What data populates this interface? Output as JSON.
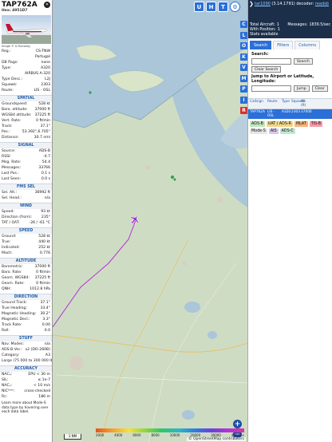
{
  "left_panel": {
    "callsign": "TAP762A",
    "hex_label": "Hex:",
    "hex": "4951D7",
    "photo_credit": "Image © G.Runsaeg",
    "rows_top": [
      {
        "k": "Reg.:",
        "v": "CS-TNW"
      },
      {
        "k": "",
        "v": "Portugal"
      },
      {
        "k": "DB flags:",
        "v": "none"
      },
      {
        "k": "Type:",
        "v": "A320"
      },
      {
        "k": "",
        "v": "AIRBUS A-320"
      },
      {
        "k": "Type Desc.:",
        "v": "L2J"
      },
      {
        "k": "Squawk:",
        "v": "2303"
      },
      {
        "k": "Route:",
        "v": "LIS - OSL"
      }
    ],
    "sections": [
      {
        "title": "SPATIAL",
        "rows": [
          {
            "k": "Groundspeed:",
            "v": "528 kt"
          },
          {
            "k": "Baro. altitude:",
            "v": "37000 ft"
          },
          {
            "k": "WGS84 altitude:",
            "v": "37225 ft"
          },
          {
            "k": "Vert. Rate:",
            "v": "0 ft/min"
          },
          {
            "k": "Track:",
            "v": "37.1°"
          },
          {
            "k": "Pos.:",
            "v": "53.392°,6.705°"
          },
          {
            "k": "Distance:",
            "v": "30.7 nmi"
          }
        ]
      },
      {
        "title": "SIGNAL",
        "rows": [
          {
            "k": "Source:",
            "v": "ADS-B"
          },
          {
            "k": "RSSI:",
            "v": "-4.7"
          },
          {
            "k": "Msg. Rate:",
            "v": "54.4"
          },
          {
            "k": "Messages:",
            "v": "33766"
          },
          {
            "k": "Last Pos.:",
            "v": "0.1 s"
          },
          {
            "k": "Last Seen:",
            "v": "0.0 s"
          }
        ]
      },
      {
        "title": "FMS SEL",
        "rows": [
          {
            "k": "Sel. Alt.:",
            "v": "36992 ft"
          },
          {
            "k": "Sel. Head.:",
            "v": "n/a"
          }
        ]
      },
      {
        "title": "WIND",
        "rows": [
          {
            "k": "Speed:",
            "v": "93 kt"
          },
          {
            "k": "Direction (from):",
            "v": "235°"
          },
          {
            "k": "TAT / OAT:",
            "v": "-26 / -61 °C"
          }
        ]
      },
      {
        "title": "SPEED",
        "rows": [
          {
            "k": "Ground:",
            "v": "528 kt"
          },
          {
            "k": "True:",
            "v": "440 kt"
          },
          {
            "k": "Indicated:",
            "v": "252 kt"
          },
          {
            "k": "Mach:",
            "v": "0.776"
          }
        ]
      },
      {
        "title": "ALTITUDE",
        "rows": [
          {
            "k": "Barometric:",
            "v": "37000 ft"
          },
          {
            "k": "Baro. Rate:",
            "v": "0 ft/min"
          },
          {
            "k": "Geom. WGS84:",
            "v": "37225 ft"
          },
          {
            "k": "Geom. Rate:",
            "v": "0 ft/min"
          },
          {
            "k": "QNH:",
            "v": "1012.8 hPa"
          }
        ]
      },
      {
        "title": "DIRECTION",
        "rows": [
          {
            "k": "Ground Track:",
            "v": "37.1°"
          },
          {
            "k": "True Heading:",
            "v": "33.4°"
          },
          {
            "k": "Magnetic Heading:",
            "v": "30.2°"
          },
          {
            "k": "Magnetic Decl.:",
            "v": "3.3°"
          },
          {
            "k": "Track Rate:",
            "v": "0.00"
          },
          {
            "k": "Roll:",
            "v": "0.0"
          }
        ]
      },
      {
        "title": "STUFF",
        "rows": [
          {
            "k": "Nav. Modes:",
            "v": "n/a"
          },
          {
            "k": "ADS-B Ver.:",
            "v": "v2 (DO-260B)"
          },
          {
            "k": "Category:",
            "v": "A3"
          },
          {
            "k": "Large (75 000 to 300 000 lb)",
            "v": ""
          }
        ]
      },
      {
        "title": "ACCURACY",
        "rows": [
          {
            "k": "NACₚ:",
            "v": "EPU < 30 m"
          },
          {
            "k": "SIL:",
            "v": "≤ 1e-7"
          },
          {
            "k": "NACᵥ:",
            "v": "< 10 m/s"
          },
          {
            "k": "NICᵇᵃʳᵒ:",
            "v": "cross-checked"
          },
          {
            "k": "Rᴄ:",
            "v": "186 m"
          }
        ]
      }
    ],
    "footer_note": "Learn more about Mode-S data type by hovering over each data label."
  },
  "map": {
    "top_buttons": [
      "U",
      "H",
      "T"
    ],
    "vertical_buttons": [
      "C",
      "L",
      "O",
      "K",
      "V",
      "M",
      "P",
      "I",
      "R"
    ],
    "zoom_in": "+",
    "zoom_out": "−",
    "scale_label": "1 NM",
    "colorbar_ticks": [
      "2000",
      "4000",
      "6000",
      "8000",
      "10000",
      "20000",
      "30000",
      "40000+"
    ],
    "attribution": "© OpenStreetMap contributors",
    "aircraft_icon": "airplane-icon",
    "colors": {
      "track": "#b233d6",
      "aircraft": "#9b30c9",
      "water": "#aac6d8",
      "land": "#cfdcc4"
    }
  },
  "right_panel": {
    "version_link": "tar1090",
    "version_text": "(3.14.1791) decoder:",
    "decoder_link": "readsb",
    "stats": [
      {
        "k": "Total Aircraft:",
        "v": "1"
      },
      {
        "k": "Messages:",
        "v": "1839.5/sec"
      },
      {
        "k": "With Position:",
        "v": "1"
      },
      {
        "k": "",
        "v": ""
      },
      {
        "k": "Stats available",
        "v": ""
      }
    ],
    "tabs": [
      "Search",
      "Filters",
      "Columns"
    ],
    "active_tab": "Search",
    "search_label": "Search:",
    "search_button": "Search",
    "clear_search_button": "Clear Search",
    "jump_label": "Jump to Airport or Latitude, Longitude:",
    "jump_button": "Jump",
    "clear_button": "Clear",
    "table_headers": [
      "Callsign",
      "Route",
      "Type",
      "Squawk",
      "Alt. (ft)",
      ""
    ],
    "table_row": [
      "TAP762A",
      "LIS - OSL",
      "A320",
      "2303",
      "37000",
      ""
    ],
    "source_tags": [
      {
        "label": "ADS-B",
        "bg": "#bfe5bf"
      },
      {
        "label": "UAT / ADS-R",
        "bg": "#f2d58a"
      },
      {
        "label": "MLAT",
        "bg": "#f5b37b"
      },
      {
        "label": "TIS-B",
        "bg": "#f59aa8"
      },
      {
        "label": "Mode-S",
        "bg": "#e6e6e6"
      },
      {
        "label": "AIS",
        "bg": "#d8c5f2"
      },
      {
        "label": "ADS-C",
        "bg": "#bfe8d2"
      }
    ]
  }
}
